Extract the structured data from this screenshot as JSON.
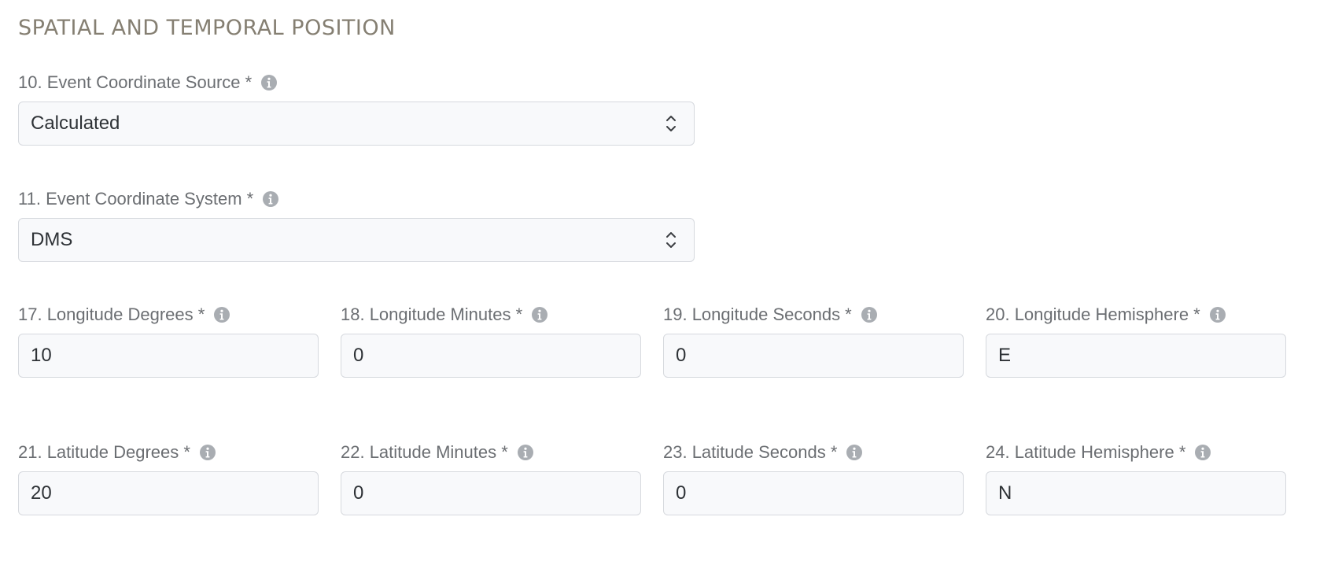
{
  "section": {
    "title": "SPATIAL AND TEMPORAL POSITION"
  },
  "fields": {
    "coordinate_source": {
      "label": "10. Event Coordinate Source *",
      "value": "Calculated"
    },
    "coordinate_system": {
      "label": "11. Event Coordinate System *",
      "value": "DMS"
    },
    "longitude_degrees": {
      "label": "17. Longitude Degrees *",
      "value": "10"
    },
    "longitude_minutes": {
      "label": "18. Longitude Minutes *",
      "value": "0"
    },
    "longitude_seconds": {
      "label": "19. Longitude Seconds *",
      "value": "0"
    },
    "longitude_hemisphere": {
      "label": "20. Longitude Hemisphere *",
      "value": "E"
    },
    "latitude_degrees": {
      "label": "21. Latitude Degrees *",
      "value": "20"
    },
    "latitude_minutes": {
      "label": "22. Latitude Minutes *",
      "value": "0"
    },
    "latitude_seconds": {
      "label": "23. Latitude Seconds *",
      "value": "0"
    },
    "latitude_hemisphere": {
      "label": "24. Latitude Hemisphere *",
      "value": "N"
    }
  },
  "icons": {
    "info": "info-icon",
    "select_arrows": "chevron-up-down-icon"
  },
  "colors": {
    "section_title": "#857f72",
    "label_text": "#6b6e72",
    "info_icon": "#a9adb2",
    "control_border": "#d6d9de",
    "control_background": "#f8f9fb",
    "value_text": "#2e3236"
  }
}
